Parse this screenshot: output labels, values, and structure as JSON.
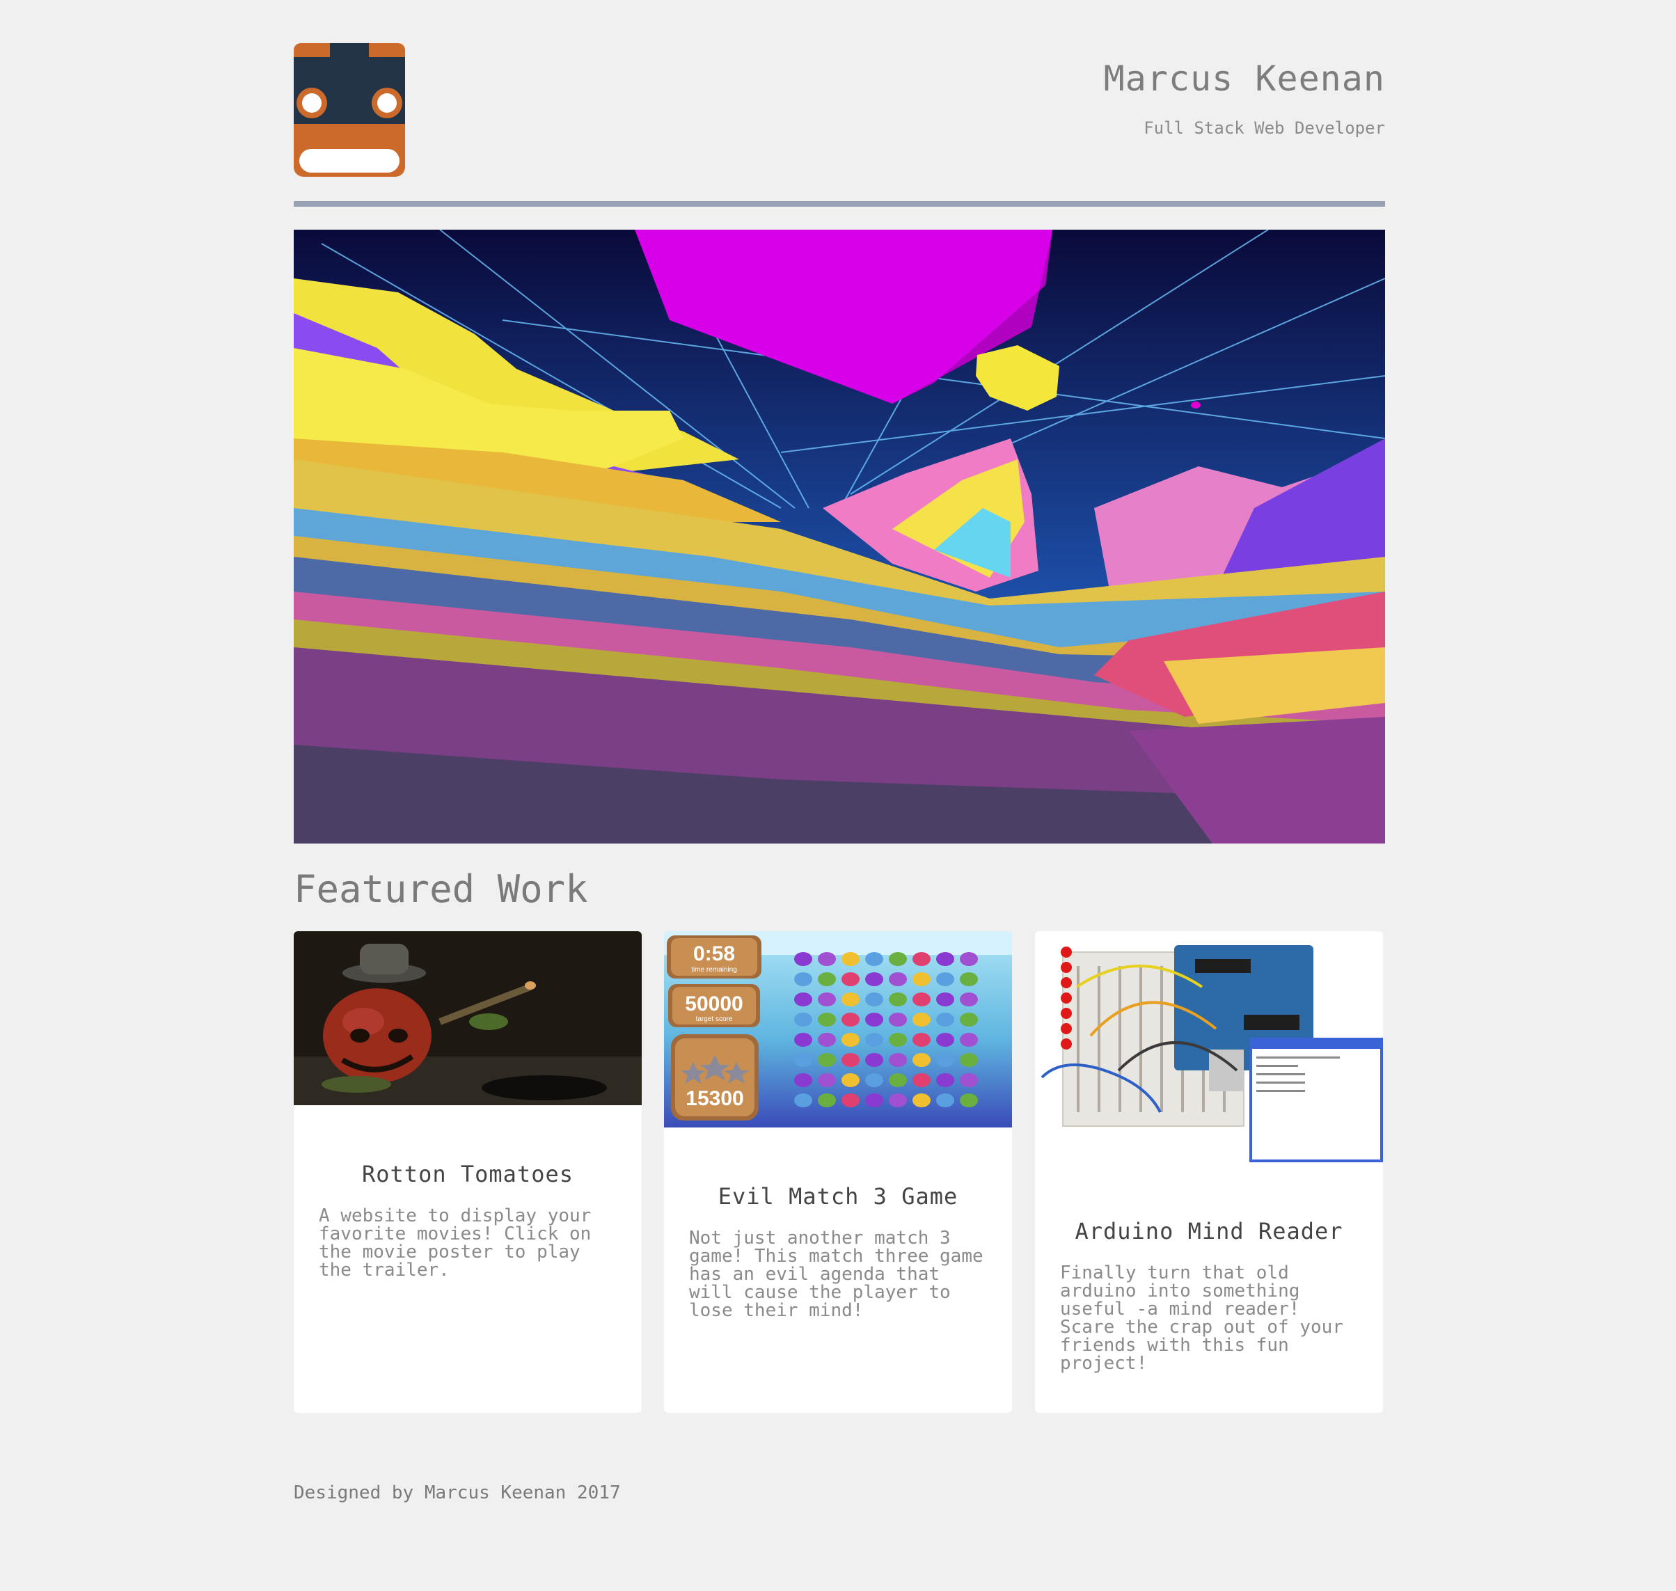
{
  "header": {
    "name": "Marcus Keenan",
    "subtitle": "Full Stack Web Developer",
    "logo_icon": "robot-face-icon"
  },
  "hero": {
    "image": "abstract-polygon-landscape"
  },
  "featured": {
    "title": "Featured Work",
    "cards": [
      {
        "title": "Rotton Tomatoes",
        "description": "A website to display your favorite movies! Click on the movie poster to play the trailer.",
        "image": "tomato-character-photo"
      },
      {
        "title": "Evil Match 3 Game",
        "description": "Not just another match 3 game! This match three game has an evil agenda that will cause the player to lose their mind!",
        "image": "fish-match-three-game",
        "game_hud": {
          "time": "0:58",
          "time_label": "time remaining",
          "target": "50000",
          "target_label": "target score",
          "score": "15300"
        }
      },
      {
        "title": "Arduino Mind Reader",
        "description": "Finally turn that old arduino into something useful -a mind reader! Scare the crap out of your friends with this fun project!",
        "image": "arduino-breadboard-photo"
      }
    ]
  },
  "footer": {
    "text": "Designed by Marcus Keenan 2017"
  },
  "colors": {
    "background": "#f0f0f0",
    "divider": "#97a3b5",
    "logo_orange": "#cc6a2c",
    "logo_navy": "#243447"
  }
}
